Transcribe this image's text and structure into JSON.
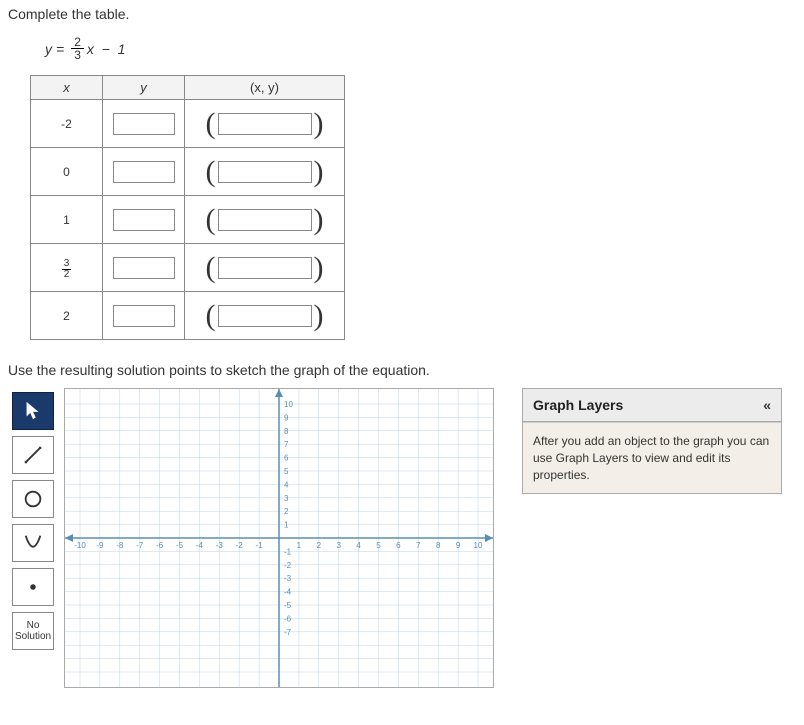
{
  "prompt": "Complete the table.",
  "equation": {
    "lhs": "y",
    "eq": "=",
    "num": "2",
    "den": "3",
    "var": "x",
    "rest": "  −  1"
  },
  "table": {
    "headers": {
      "x": "x",
      "y": "y",
      "xy": "(x, y)"
    },
    "rows": [
      {
        "x": "-2"
      },
      {
        "x": "0"
      },
      {
        "x": "1"
      },
      {
        "x_frac": {
          "n": "3",
          "d": "2"
        }
      },
      {
        "x": "2"
      }
    ]
  },
  "prompt2": "Use the resulting solution points to sketch the graph of the equation.",
  "tools": {
    "nosol_line1": "No",
    "nosol_line2": "Solution"
  },
  "layers": {
    "title": "Graph Layers",
    "chevron": "«",
    "body": "After you add an object to the graph you can use Graph Layers to view and edit its properties."
  },
  "chart_data": {
    "type": "scatter",
    "xlim": [
      -10,
      10
    ],
    "ylim": [
      -10,
      10
    ],
    "xticks": [
      -10,
      -9,
      -8,
      -7,
      -6,
      -5,
      -4,
      -3,
      -2,
      -1,
      1,
      2,
      3,
      4,
      5,
      6,
      7,
      8,
      9,
      10
    ],
    "yticks": [
      -7,
      -6,
      -5,
      -4,
      -3,
      -2,
      -1,
      1,
      2,
      3,
      4,
      5,
      6,
      7,
      8,
      9,
      10
    ],
    "x": [],
    "y": [],
    "grid": true
  }
}
